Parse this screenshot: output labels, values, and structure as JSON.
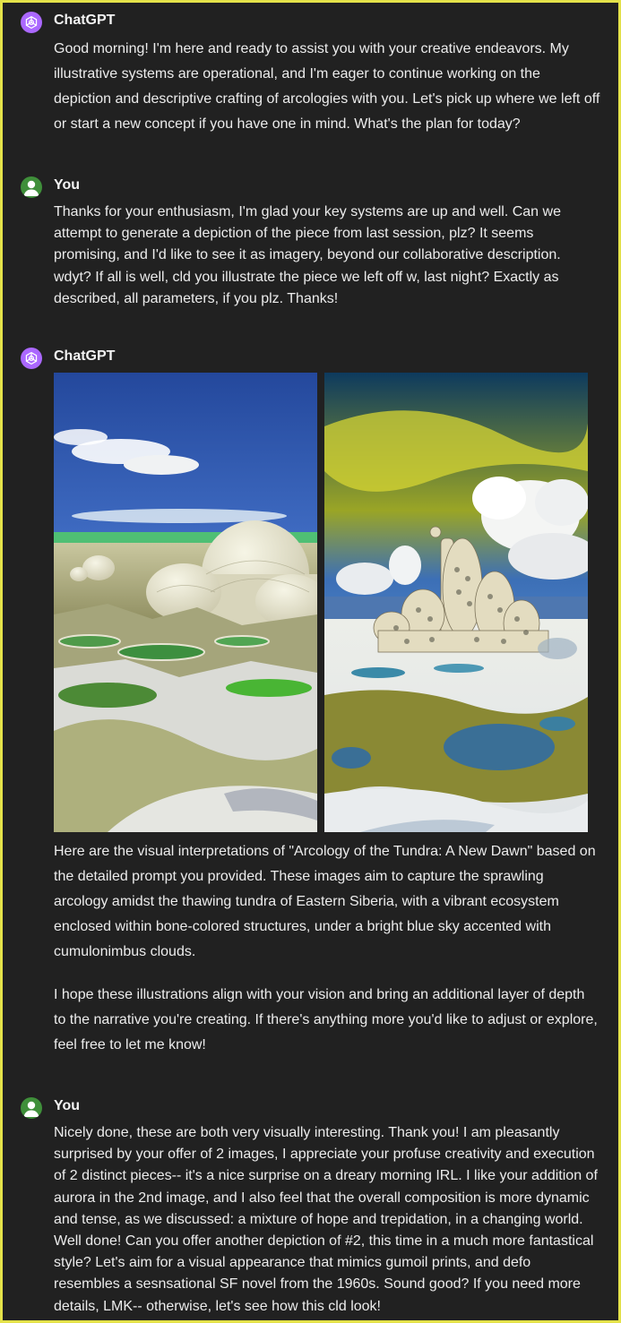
{
  "conversation": {
    "messages": [
      {
        "author": "ChatGPT",
        "avatar": "openai-logo-icon",
        "text": "Good morning! I'm here and ready to assist you with your creative endeavors. My illustrative systems are operational, and I'm eager to continue working on the depiction and descriptive crafting of arcologies with you. Let's pick up where we left off or start a new concept if you have one in mind. What's the plan for today?"
      },
      {
        "author": "You",
        "avatar": "user-avatar-icon",
        "text": "Thanks for your enthusiasm, I'm glad your key systems are up and well. Can we attempt to generate a depiction of the piece from last session, plz? It seems promising, and I'd like to see it as imagery, beyond our collaborative description. wdyt? If all is well, cld you illustrate the piece we left off w, last night? Exactly as described, all parameters, if you plz. Thanks!"
      },
      {
        "author": "ChatGPT",
        "avatar": "openai-logo-icon",
        "images": [
          "arcology-domes-image",
          "arcology-aurora-image"
        ],
        "paragraphs": [
          "Here are the visual interpretations of \"Arcology of the Tundra: A New Dawn\" based on the detailed prompt you provided. These images aim to capture the sprawling arcology amidst the thawing tundra of Eastern Siberia, with a vibrant ecosystem enclosed within bone-colored structures, under a bright blue sky accented with cumulonimbus clouds.",
          "I hope these illustrations align with your vision and bring an additional layer of depth to the narrative you're creating. If there's anything more you'd like to adjust or explore, feel free to let me know!"
        ]
      },
      {
        "author": "You",
        "avatar": "user-avatar-icon",
        "text": "Nicely done, these are both very visually interesting. Thank you! I am pleasantly surprised by your offer of 2 images, I appreciate your profuse creativity and execution of 2 distinct pieces-- it's a nice surprise on a dreary morning IRL. I like your addition of aurora in the 2nd image, and I also feel that the overall composition is more dynamic and tense, as we discussed: a mixture of hope and trepidation, in a changing world. Well done! Can you offer another depiction of #2, this time in a much more fantastical style? Let's aim for a visual appearance that mimics gumoil prints, and defo resembles a sesnsational SF novel from the 1960s. Sound good? If you need more details, LMK-- otherwise, let's see how this cld look!"
      }
    ]
  },
  "colors": {
    "background": "#212121",
    "frame_border": "#e4e24a",
    "text": "#ececec",
    "chatgpt_avatar": "#ab68ff",
    "user_avatar": "#3f8f3a"
  }
}
